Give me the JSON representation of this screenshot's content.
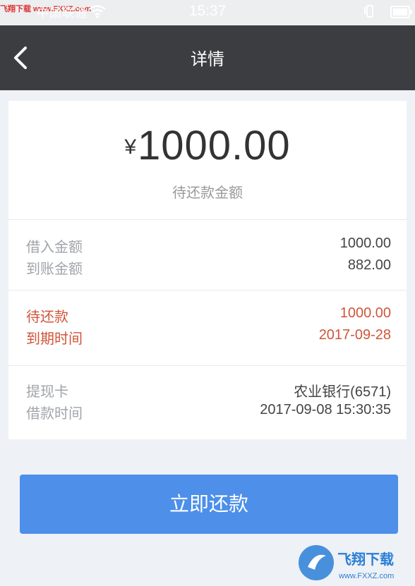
{
  "status_bar": {
    "watermark": "飞翔下载 www.FXXZ.com",
    "carrier": "中国联通",
    "time": "15:37"
  },
  "header": {
    "title": "详情"
  },
  "summary": {
    "currency_symbol": "¥",
    "amount": "1000.00",
    "label": "待还款金额"
  },
  "details": {
    "borrowed_label": "借入金额",
    "borrowed_value": "1000.00",
    "received_label": "到账金额",
    "received_value": "882.00",
    "due_label": "待还款",
    "due_value": "1000.00",
    "due_date_label": "到期时间",
    "due_date_value": "2017-09-28",
    "card_label": "提现卡",
    "card_value": "农业银行(6571)",
    "loan_time_label": "借款时间",
    "loan_time_value": "2017-09-08 15:30:35"
  },
  "action": {
    "repay_label": "立即还款"
  },
  "watermark_logo": {
    "text": "飞翔下载",
    "url": "www.FXXZ.com"
  },
  "colors": {
    "header_bg": "#3b3d40",
    "accent": "#4d8fe9",
    "due_red": "#d0553a"
  }
}
